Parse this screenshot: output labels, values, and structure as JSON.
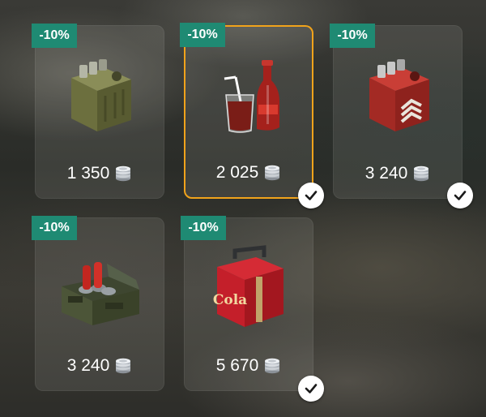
{
  "items": [
    {
      "discount": "-10%",
      "price": "1 350",
      "icon": "olive-jerrycan-icon",
      "selected": false,
      "purchased": false
    },
    {
      "discount": "-10%",
      "price": "2 025",
      "icon": "cola-drink-icon",
      "selected": true,
      "purchased": true
    },
    {
      "discount": "-10%",
      "price": "3 240",
      "icon": "red-jerrycan-icon",
      "selected": false,
      "purchased": true
    },
    {
      "discount": "-10%",
      "price": "3 240",
      "icon": "ammo-crate-cola-icon",
      "selected": false,
      "purchased": false
    },
    {
      "discount": "-10%",
      "price": "5 670",
      "icon": "red-cola-box-icon",
      "label": "Cola",
      "selected": false,
      "purchased": true
    }
  ],
  "colors": {
    "badge": "#1f8a73",
    "selected_border": "#f1a31b",
    "price_text": "#ffffff"
  }
}
